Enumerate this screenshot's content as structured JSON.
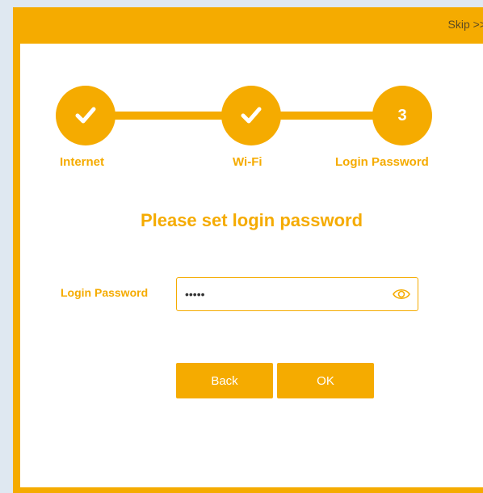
{
  "header": {
    "skip_label": "Skip >>"
  },
  "stepper": {
    "steps": [
      {
        "label": "Internet",
        "state": "done"
      },
      {
        "label": "Wi-Fi",
        "state": "done"
      },
      {
        "label": "Login Password",
        "state": "current",
        "number": "3"
      }
    ]
  },
  "form": {
    "heading": "Please set login password",
    "password_label": "Login Password",
    "password_value": "•••••"
  },
  "buttons": {
    "back_label": "Back",
    "ok_label": "OK"
  },
  "colors": {
    "accent": "#f5ab00",
    "background": "#dfe8f1",
    "panel": "#ffffff"
  }
}
